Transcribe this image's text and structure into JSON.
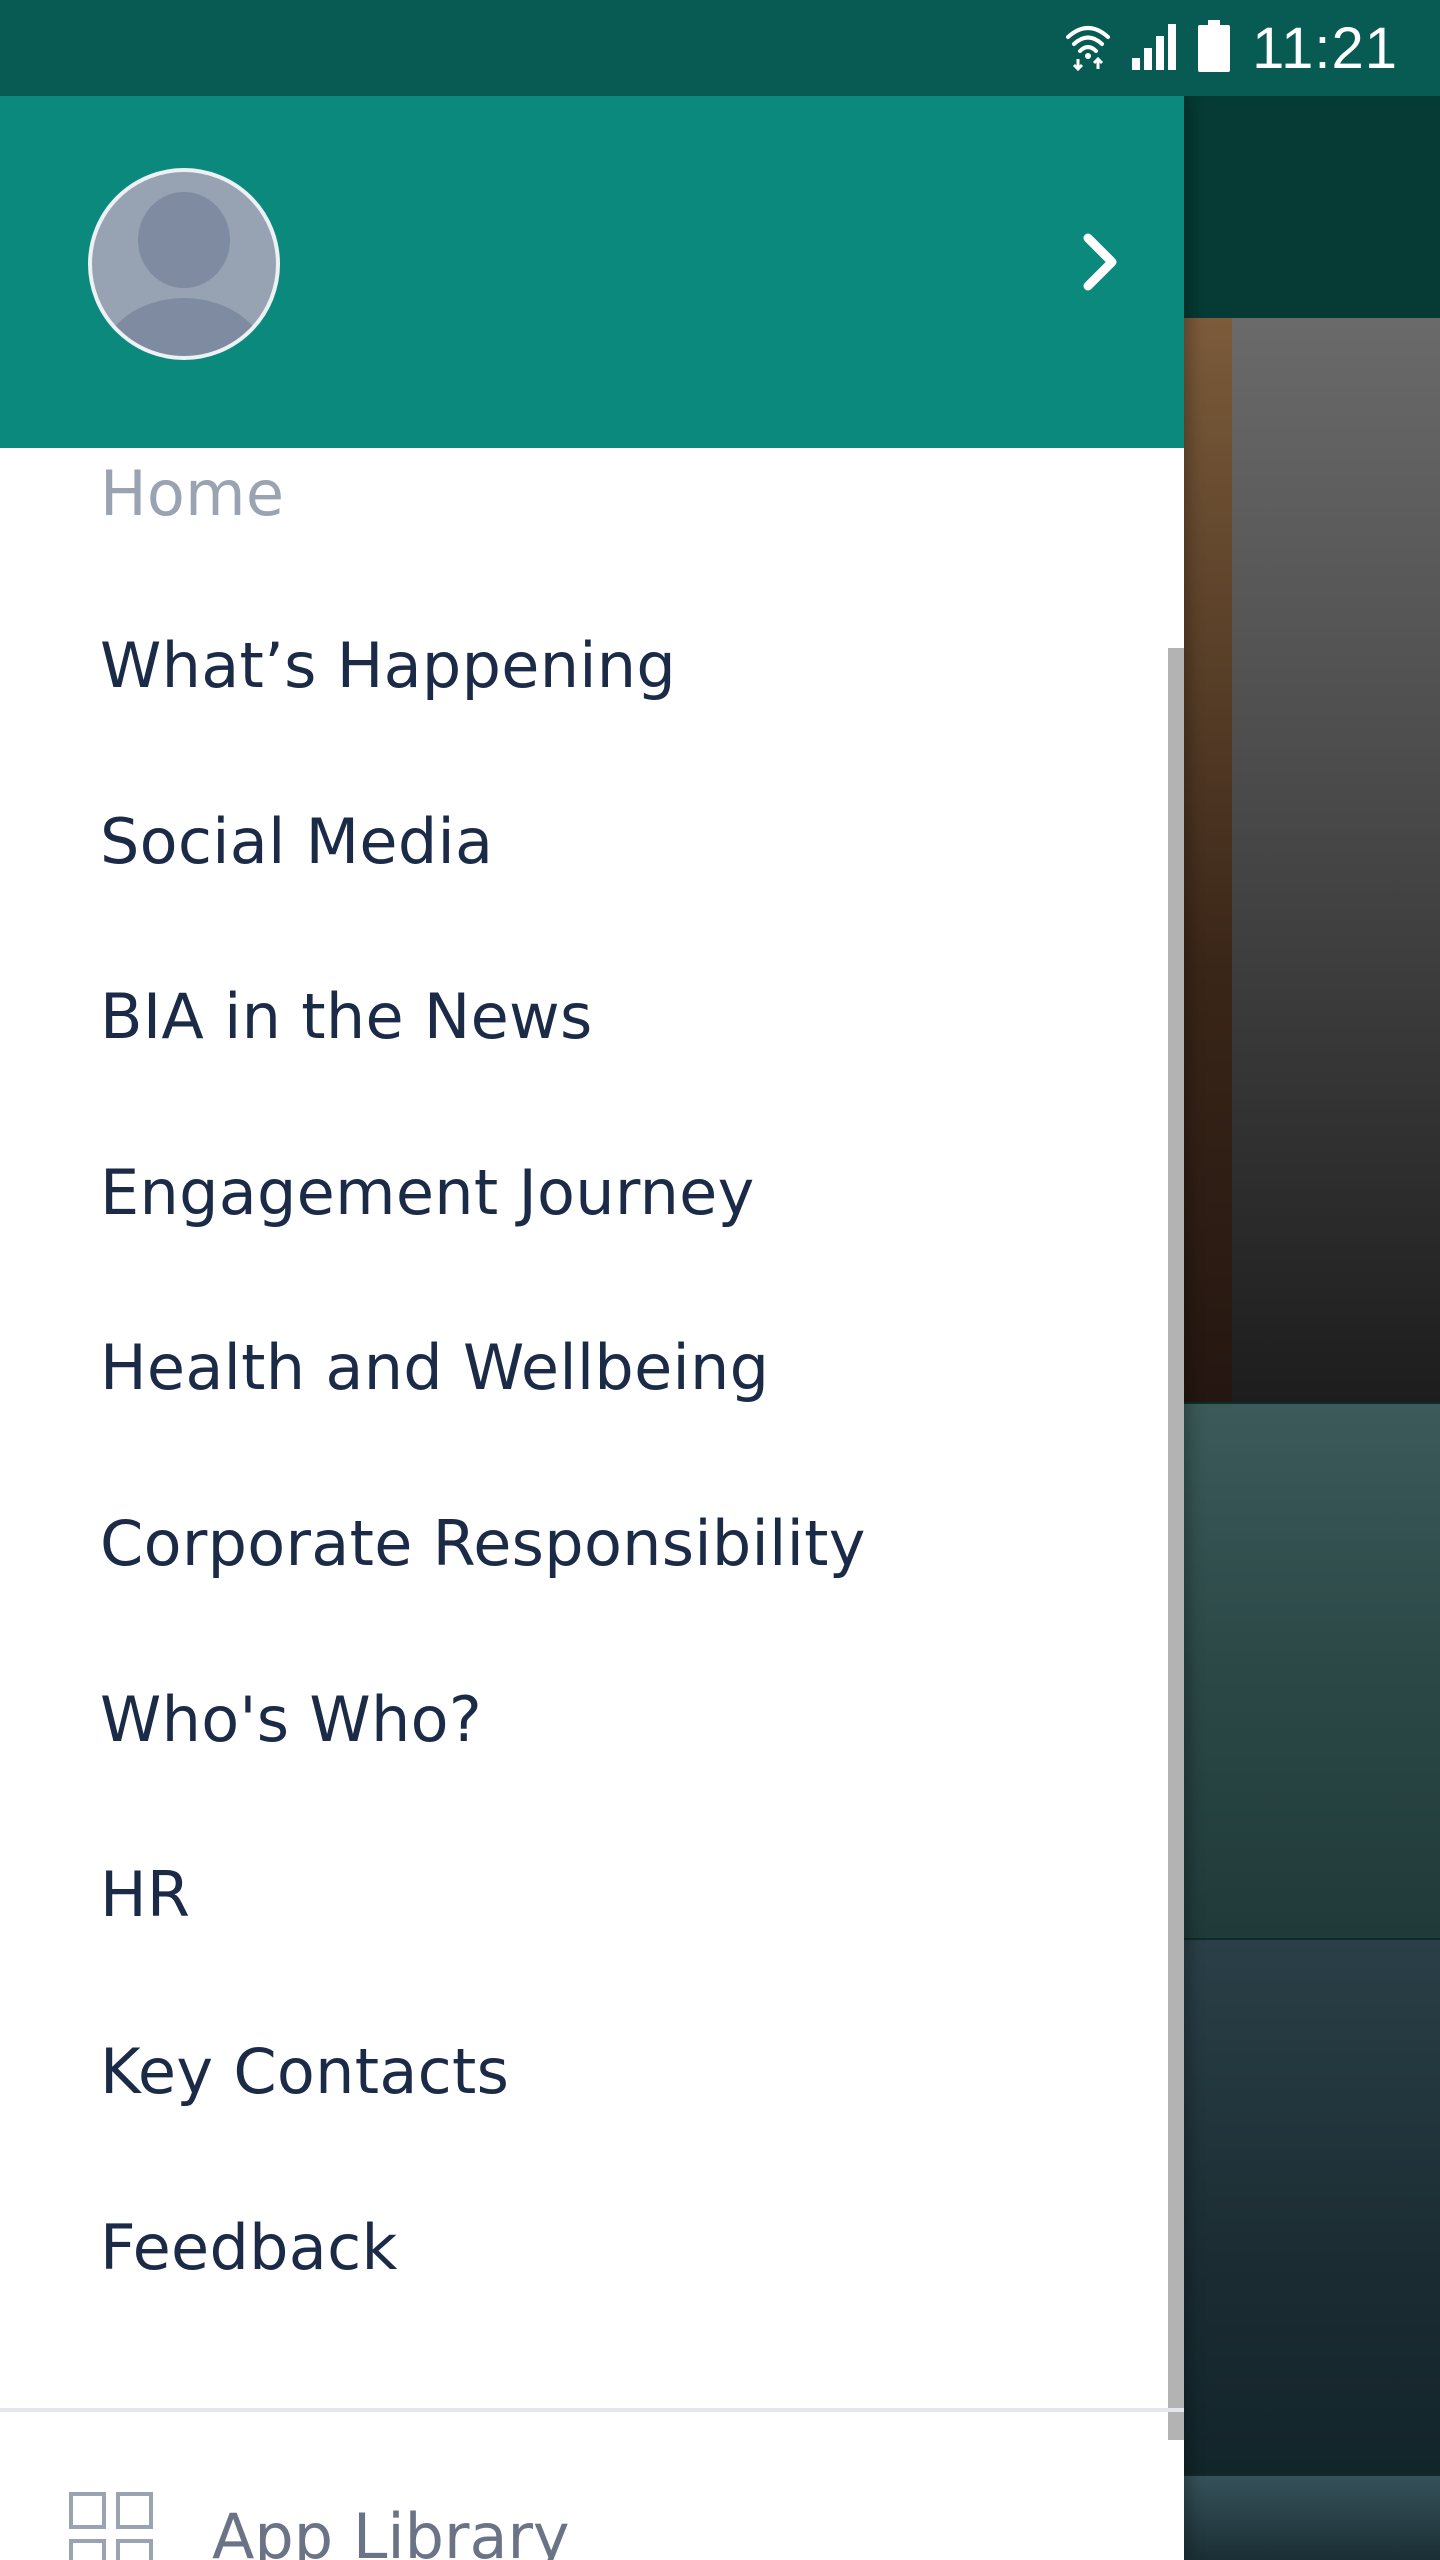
{
  "status_bar": {
    "time": "11:21",
    "icons": [
      "wifi-icon",
      "signal-icon",
      "battery-icon"
    ]
  },
  "profile": {
    "avatar_icon": "avatar-placeholder-icon",
    "chevron_icon": "chevron-right-icon"
  },
  "menu": {
    "home": "Home",
    "items": [
      "What’s Happening",
      "Social Media",
      "BIA in the News",
      "Engagement Journey",
      "Health and Wellbeing",
      "Corporate Responsibility",
      "Who's Who?",
      "HR",
      "Key Contacts",
      "Feedback"
    ]
  },
  "footer": {
    "app_library_label": "App Library",
    "app_library_icon": "grid-icon"
  },
  "colors": {
    "status_bar": "#075b53",
    "drawer_header": "#0b897d",
    "menu_text": "#1b2b47",
    "menu_text_muted": "#9aa3b2",
    "footer_text": "#6b7486"
  }
}
